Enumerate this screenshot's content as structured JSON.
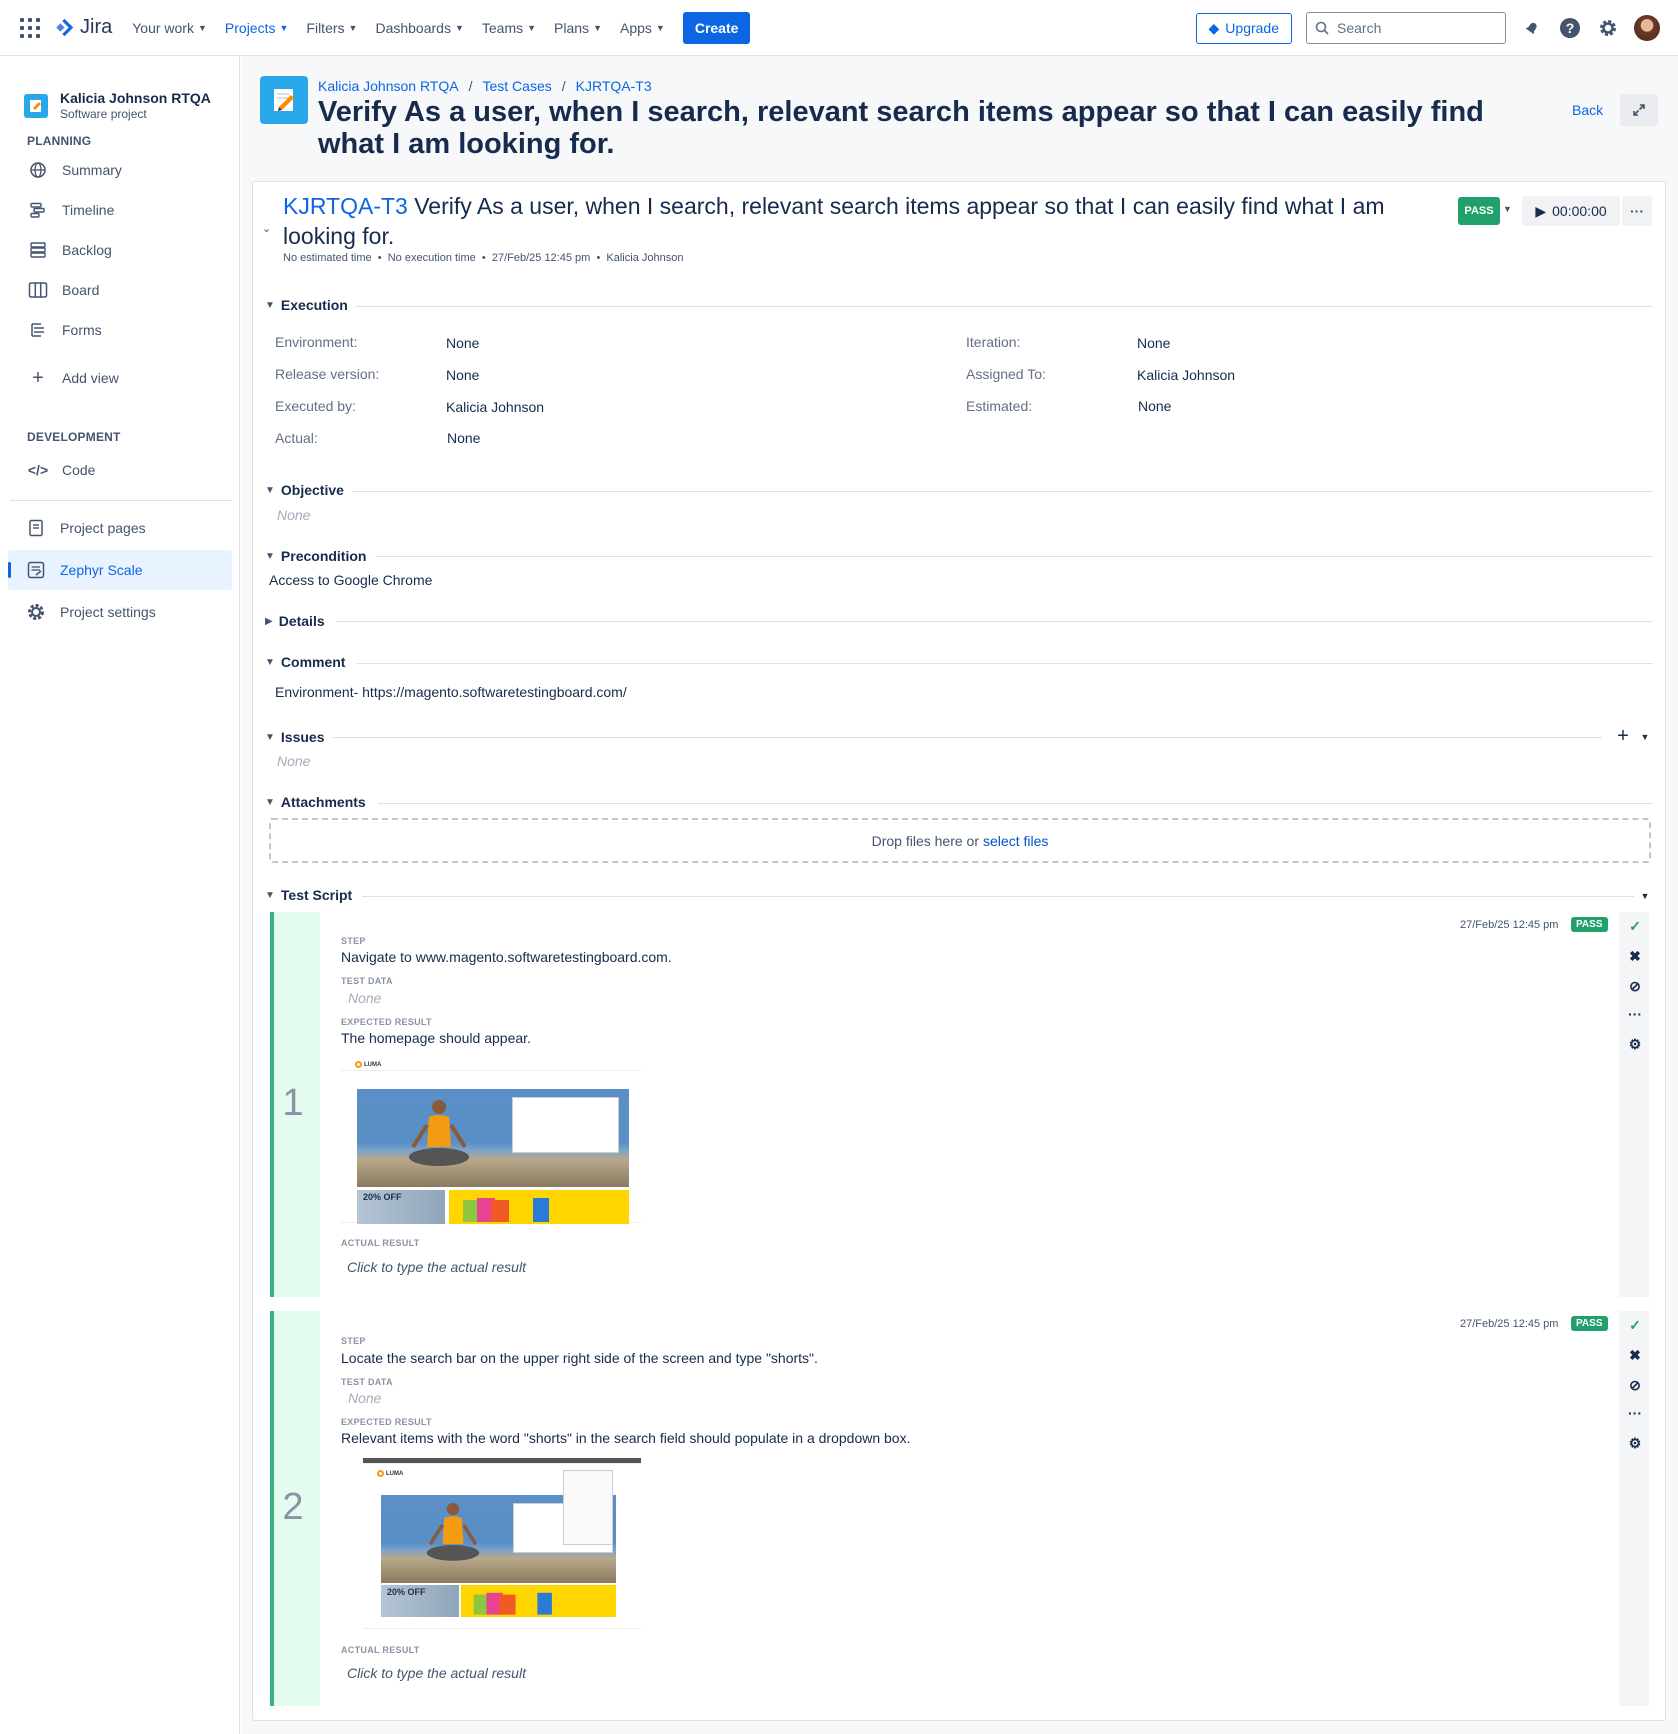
{
  "topnav": {
    "logo": "Jira",
    "items": [
      {
        "label": "Your work"
      },
      {
        "label": "Projects"
      },
      {
        "label": "Filters"
      },
      {
        "label": "Dashboards"
      },
      {
        "label": "Teams"
      },
      {
        "label": "Plans"
      },
      {
        "label": "Apps"
      }
    ],
    "create": "Create",
    "upgrade": "Upgrade",
    "search_placeholder": "Search",
    "accent": "#0c66e4"
  },
  "sidebar": {
    "project_name": "Kalicia Johnson RTQA",
    "project_type": "Software project",
    "planning_title": "PLANNING",
    "planning_items": [
      {
        "label": "Summary",
        "icon": "globe-icon"
      },
      {
        "label": "Timeline",
        "icon": "timeline-icon"
      },
      {
        "label": "Backlog",
        "icon": "backlog-icon"
      },
      {
        "label": "Board",
        "icon": "board-icon"
      },
      {
        "label": "Forms",
        "icon": "forms-icon"
      }
    ],
    "add_view": "Add view",
    "development_title": "DEVELOPMENT",
    "code": "Code",
    "project_pages": "Project pages",
    "zephyr_scale": "Zephyr Scale",
    "project_settings": "Project settings"
  },
  "header": {
    "breadcrumb": [
      "Kalicia Johnson RTQA",
      "Test Cases",
      "KJRTQA-T3"
    ],
    "title": "Verify As a user, when I search, relevant search items appear so that I can easily find what I am looking for.",
    "back": "Back"
  },
  "testcase": {
    "key": "KJRTQA-T3",
    "title": "Verify As a user, when I search, relevant search items appear so that I can easily find what I am looking for.",
    "meta": {
      "estimated": "No estimated time",
      "execution": "No execution time",
      "date": "27/Feb/25 12:45 pm",
      "user": "Kalicia Johnson"
    },
    "status": "PASS",
    "timer": "00:00:00",
    "status_color": "#22a06b"
  },
  "execution": {
    "title": "Execution",
    "environment_label": "Environment:",
    "environment": "None",
    "release_label": "Release version:",
    "release": "None",
    "executed_by_label": "Executed by:",
    "executed_by": "Kalicia Johnson",
    "actual_label": "Actual:",
    "actual": "None",
    "iteration_label": "Iteration:",
    "iteration": "None",
    "assigned_label": "Assigned To:",
    "assigned": "Kalicia Johnson",
    "estimated_label": "Estimated:",
    "estimated": "None"
  },
  "objective": {
    "title": "Objective",
    "value": "None"
  },
  "precondition": {
    "title": "Precondition",
    "value": "Access to Google Chrome"
  },
  "details": {
    "title": "Details"
  },
  "comment": {
    "title": "Comment",
    "value": "Environment- https://magento.softwaretestingboard.com/"
  },
  "issues": {
    "title": "Issues",
    "value": "None"
  },
  "attachments": {
    "title": "Attachments",
    "drop_text": "Drop files here or",
    "select": "select files"
  },
  "test_script": {
    "title": "Test Script",
    "labels": {
      "step": "STEP",
      "test_data": "TEST DATA",
      "expected": "EXPECTED RESULT",
      "actual": "ACTUAL RESULT"
    },
    "steps": [
      {
        "num": "1",
        "date": "27/Feb/25 12:45 pm",
        "status": "PASS",
        "step": "Navigate to www.magento.softwaretestingboard.com.",
        "test_data": "None",
        "expected": "The homepage should appear.",
        "actual_placeholder": "Click to type the actual result"
      },
      {
        "num": "2",
        "date": "27/Feb/25 12:45 pm",
        "status": "PASS",
        "step": "Locate the search bar on the upper right side of the screen and type \"shorts\".",
        "test_data": "None",
        "expected": "Relevant items with the word \"shorts\" in the search field should populate in a dropdown box.",
        "actual_placeholder": "Click to type the actual result"
      }
    ],
    "screenshot": {
      "brand": "LUMA",
      "offer": "20% OFF"
    }
  }
}
